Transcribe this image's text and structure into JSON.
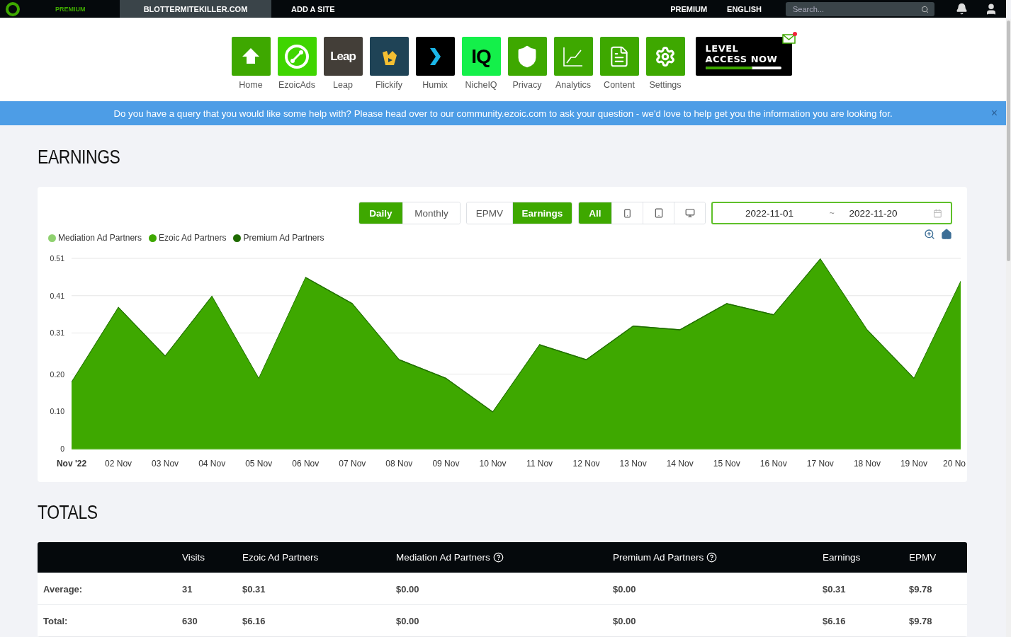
{
  "top_bar": {
    "logo_subtitle": "PREMIUM",
    "site": "BLOTTERMITEKILLER.COM",
    "add_site": "ADD A SITE",
    "links": [
      "PREMIUM",
      "ENGLISH"
    ],
    "search": {
      "placeholder": "Search..."
    }
  },
  "apps": [
    {
      "kind": "home",
      "label": "Home"
    },
    {
      "kind": "ezoicads",
      "label": "EzoicAds"
    },
    {
      "kind": "leap",
      "label": "Leap",
      "logo_text": "Leap"
    },
    {
      "kind": "flickify",
      "label": "Flickify"
    },
    {
      "kind": "humix",
      "label": "Humix"
    },
    {
      "kind": "nicheiq",
      "label": "NicheIQ",
      "logo_text": "IQ"
    },
    {
      "kind": "privacy",
      "label": "Privacy"
    },
    {
      "kind": "analytics",
      "label": "Analytics"
    },
    {
      "kind": "content",
      "label": "Content"
    },
    {
      "kind": "settings",
      "label": "Settings"
    }
  ],
  "promo": {
    "lines": [
      "LEVEL",
      "ACCESS NOW"
    ],
    "level": 0.62,
    "unread": true
  },
  "banner": {
    "text": "Do you have a query that you would like some help with? Please head over to our community.ezoic.com to ask your question - we'd love to help get you the information you are looking for.",
    "close": "×"
  },
  "earnings": {
    "title": "EARNINGS",
    "granularity": [
      {
        "label": "Daily",
        "selected": true
      },
      {
        "label": "Monthly",
        "selected": false
      }
    ],
    "metric": [
      {
        "label": "EPMV",
        "selected": false
      },
      {
        "label": "Earnings",
        "selected": true
      }
    ],
    "devices": [
      {
        "kind": "all",
        "label": "All",
        "selected": true
      },
      {
        "kind": "mobile",
        "selected": false
      },
      {
        "kind": "tablet",
        "selected": false
      },
      {
        "kind": "desktop",
        "selected": false
      }
    ],
    "date_range": {
      "start": "2022-11-01",
      "separator": "~",
      "end": "2022-11-20"
    },
    "chart_data": {
      "type": "area",
      "stacked": true,
      "grid": true,
      "categories": [
        "Nov '22",
        "02 Nov",
        "03 Nov",
        "04 Nov",
        "05 Nov",
        "06 Nov",
        "07 Nov",
        "08 Nov",
        "09 Nov",
        "10 Nov",
        "11 Nov",
        "12 Nov",
        "13 Nov",
        "14 Nov",
        "15 Nov",
        "16 Nov",
        "17 Nov",
        "18 Nov",
        "19 Nov",
        "20 No"
      ],
      "ylim": [
        0,
        0.51
      ],
      "yticks": [
        0,
        {
          "value": 0.1,
          "label": "0.10"
        },
        {
          "value": 0.2,
          "label": "0.20"
        },
        0.31,
        0.41,
        0.51
      ],
      "series": [
        {
          "name": "Mediation Ad Partners",
          "color": "#8fd16f",
          "values": [
            0,
            0,
            0,
            0,
            0,
            0,
            0,
            0,
            0,
            0,
            0,
            0,
            0,
            0,
            0,
            0,
            0,
            0,
            0,
            0
          ]
        },
        {
          "name": "Ezoic Ad Partners",
          "color": "#3ea800",
          "values": [
            0.18,
            0.38,
            0.25,
            0.41,
            0.19,
            0.46,
            0.39,
            0.24,
            0.19,
            0.1,
            0.28,
            0.24,
            0.33,
            0.32,
            0.39,
            0.36,
            0.51,
            0.32,
            0.19,
            0.45
          ]
        },
        {
          "name": "Premium Ad Partners",
          "color": "#1f6a00",
          "values": [
            0,
            0,
            0,
            0,
            0,
            0,
            0,
            0,
            0,
            0,
            0,
            0,
            0,
            0,
            0,
            0,
            0,
            0,
            0,
            0
          ]
        }
      ]
    }
  },
  "totals": {
    "title": "TOTALS",
    "columns": [
      {
        "label": "Visits",
        "help": false
      },
      {
        "label": "Ezoic Ad Partners",
        "help": false
      },
      {
        "label": "Mediation Ad Partners",
        "help": true
      },
      {
        "label": "Premium Ad Partners",
        "help": true
      },
      {
        "label": "Earnings",
        "help": false
      },
      {
        "label": "EPMV",
        "help": false
      }
    ],
    "rows": [
      {
        "label": "Average:",
        "cells": [
          "31",
          "$0.31",
          "$0.00",
          "$0.00",
          "$0.31",
          "$9.78"
        ]
      },
      {
        "label": "Total:",
        "cells": [
          "630",
          "$6.16",
          "$0.00",
          "$0.00",
          "$6.16",
          "$9.78"
        ]
      }
    ]
  }
}
